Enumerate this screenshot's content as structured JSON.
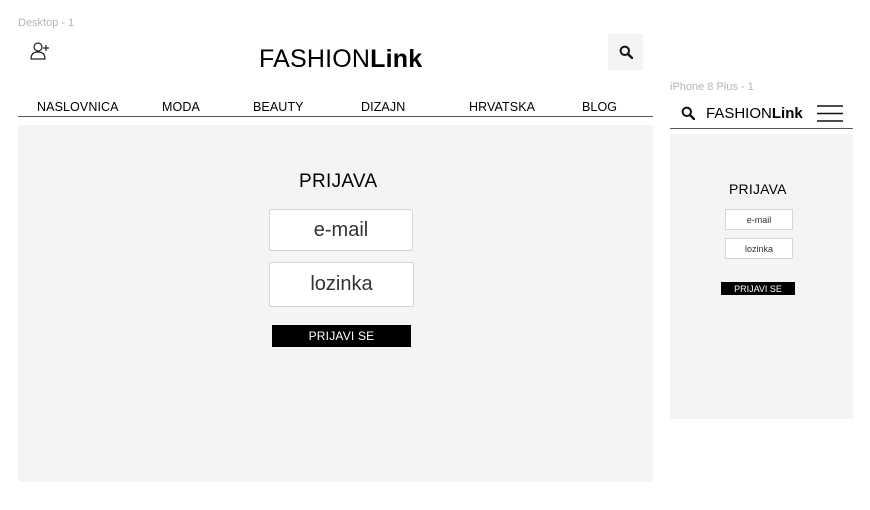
{
  "desktop": {
    "frame_label": "Desktop - 1",
    "logo": {
      "light": "FASHION",
      "bold": "Link"
    },
    "nav": [
      "NASLOVNICA",
      "MODA",
      "BEAUTY",
      "DIZAJN",
      "HRVATSKA",
      "BLOG"
    ],
    "login": {
      "title": "PRIJAVA",
      "email_placeholder": "e-mail",
      "password_placeholder": "lozinka",
      "submit_label": "PRIJAVI SE"
    },
    "icons": {
      "user": "add-user-icon",
      "search": "search-icon"
    }
  },
  "mobile": {
    "frame_label": "iPhone 8 Plus - 1",
    "logo": {
      "light": "FASHION",
      "bold": "Link"
    },
    "login": {
      "title": "PRIJAVA",
      "email_placeholder": "e-mail",
      "password_placeholder": "lozinka",
      "submit_label": "PRIJAVI SE"
    },
    "icons": {
      "search": "search-icon",
      "menu": "hamburger-menu-icon"
    }
  },
  "colors": {
    "panel": "#f4f4f4",
    "button": "#000000",
    "label": "#b5b5b5"
  }
}
